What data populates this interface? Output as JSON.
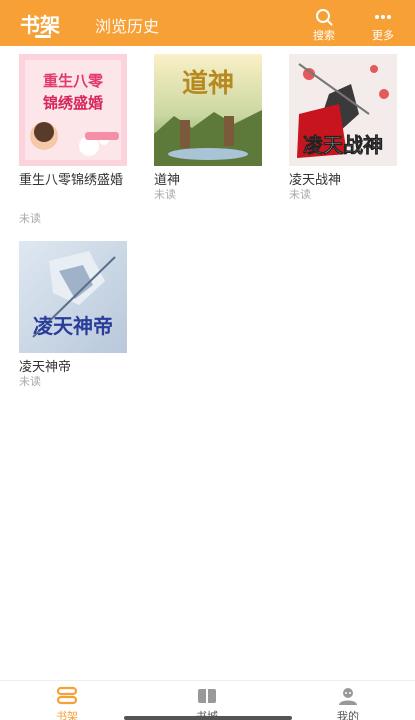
{
  "header": {
    "tabs": [
      {
        "label": "书架",
        "active": true
      },
      {
        "label": "浏览历史",
        "active": false
      }
    ],
    "search_label": "搜索",
    "more_label": "更多",
    "accent_color": "#f7a035"
  },
  "books": [
    {
      "title": "重生八零锦绣盛婚",
      "status": "未读",
      "cover_text": "重生八零锦绣盛婚"
    },
    {
      "title": "道神",
      "status": "未读",
      "cover_text": "道神"
    },
    {
      "title": "凌天战神",
      "status": "未读",
      "cover_text": "凌天战神"
    },
    {
      "title": "凌天神帝",
      "status": "未读",
      "cover_text": "凌天神帝"
    }
  ],
  "bottom_nav": [
    {
      "label": "书架",
      "active": true,
      "icon": "bookshelf-icon"
    },
    {
      "label": "书城",
      "active": false,
      "icon": "book-store-icon"
    },
    {
      "label": "我的",
      "active": false,
      "icon": "profile-icon"
    }
  ]
}
